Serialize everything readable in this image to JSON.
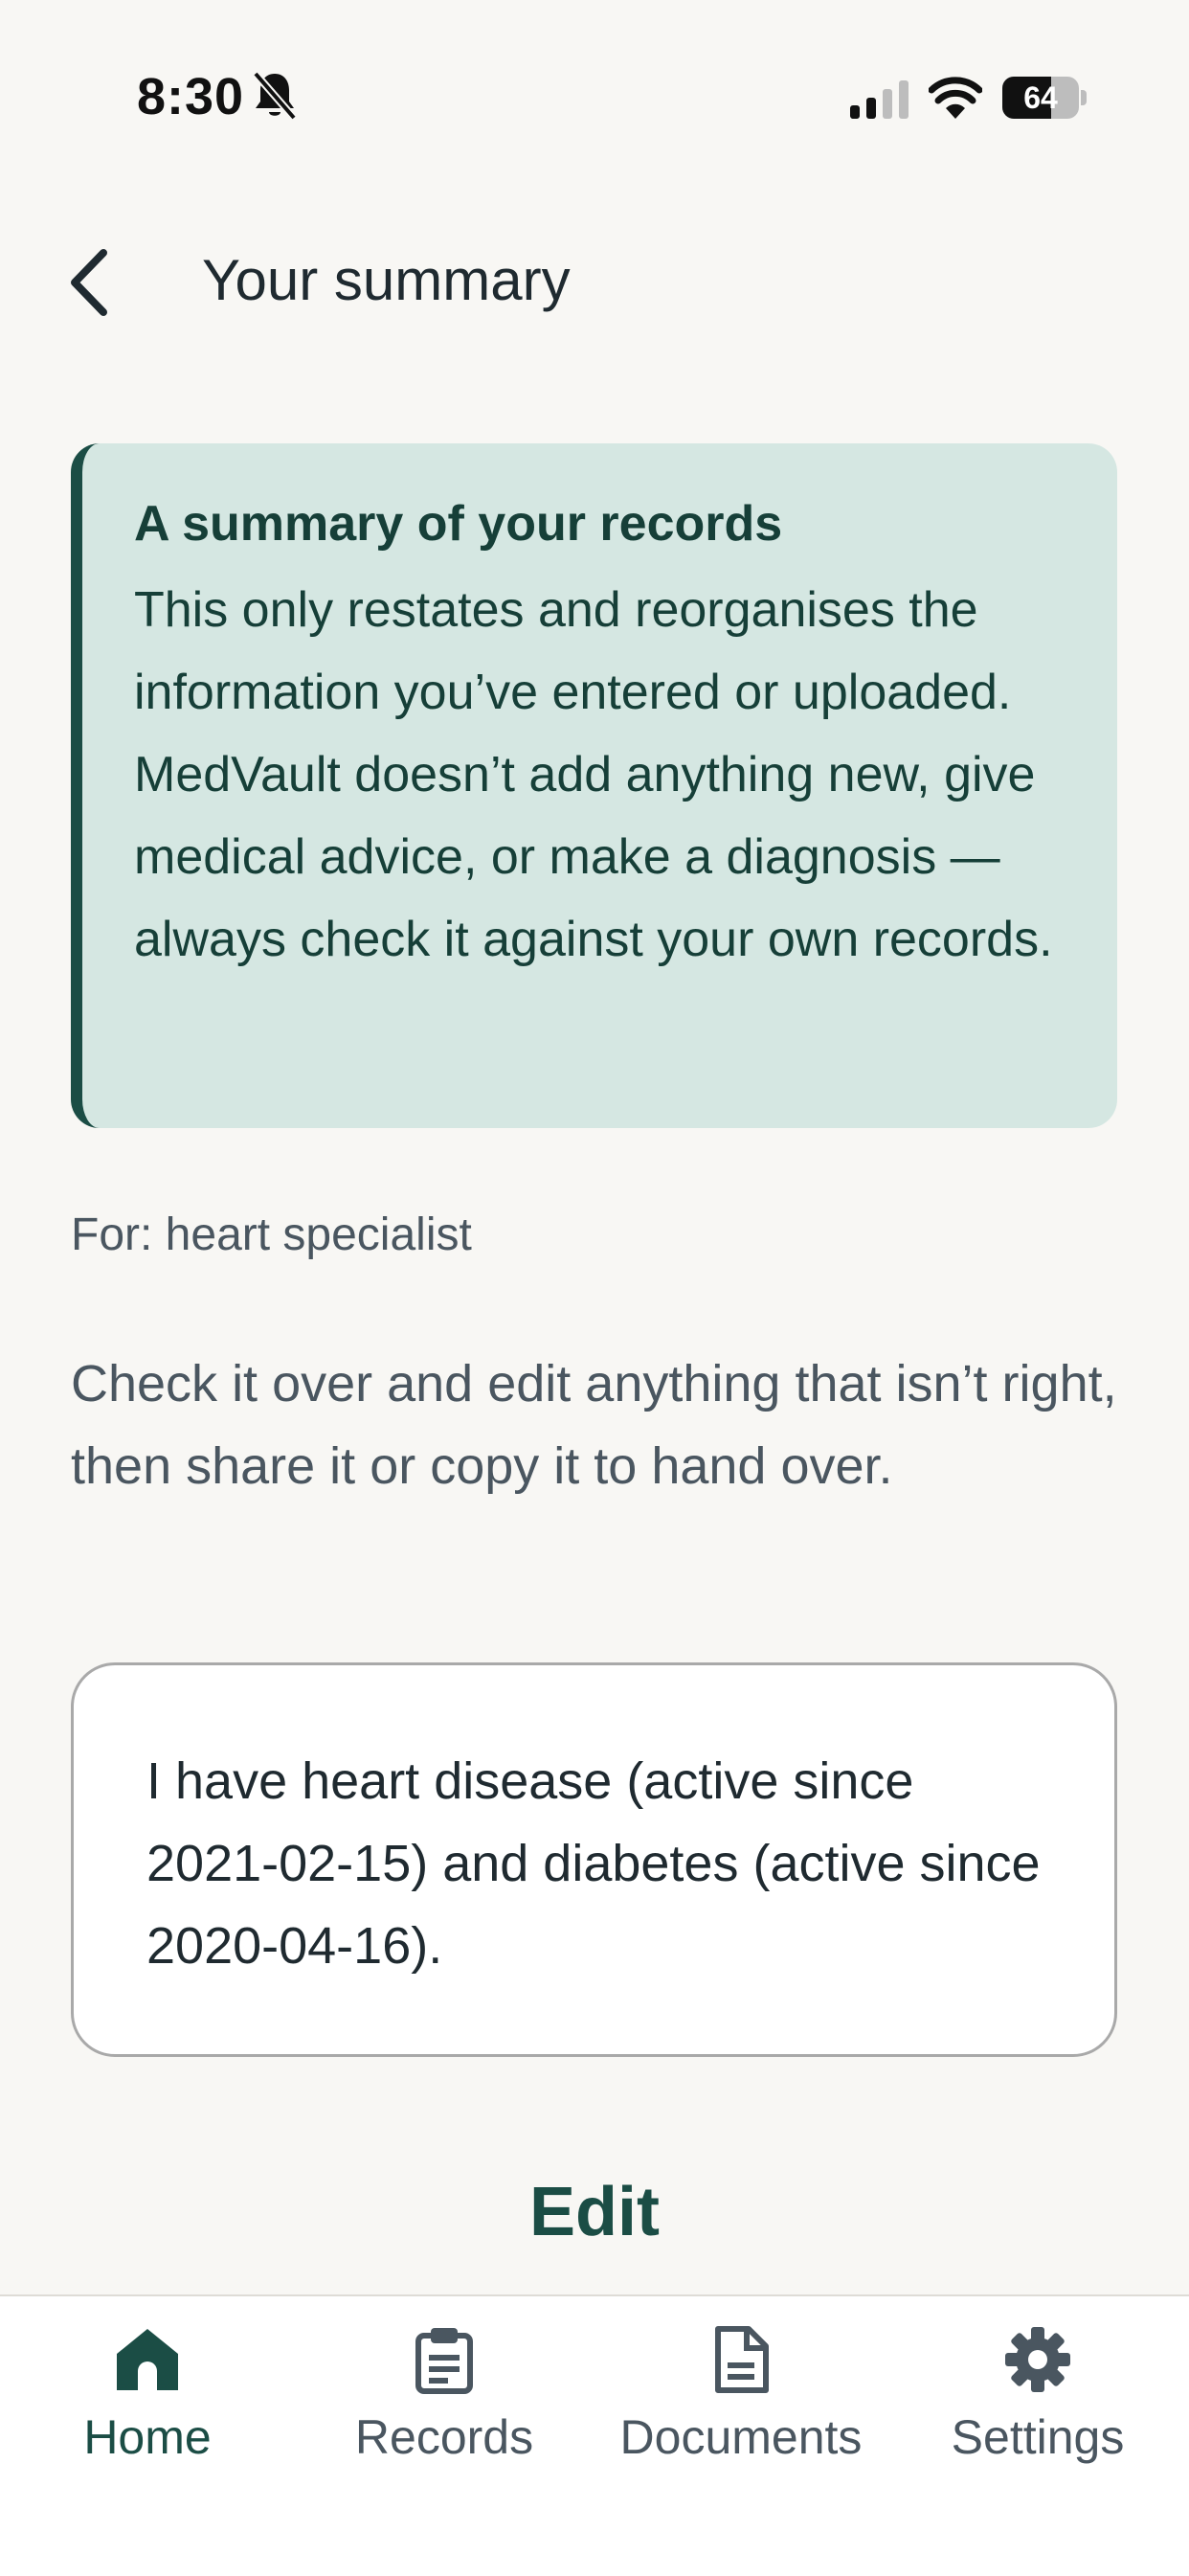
{
  "status_bar": {
    "time": "8:30",
    "battery_percent": "64",
    "battery_level": 0.64
  },
  "header": {
    "title": "Your summary"
  },
  "callout": {
    "title": "A summary of your records",
    "body": "This only restates and reorganises the information you’ve entered or uploaded. MedVault doesn’t add anything new, give medical advice, or make a diagnosis — always check it against your own records."
  },
  "for_line": "For: heart specialist",
  "instructions": "Check it over and edit anything that isn’t right, then share it or copy it to hand over.",
  "summary_text": "I have heart disease (active since 2021-02-15) and diabetes (active since 2020-04-16).",
  "edit_label": "Edit",
  "tabs": [
    {
      "label": "Home",
      "icon": "home-icon",
      "active": true
    },
    {
      "label": "Records",
      "icon": "clipboard-icon",
      "active": false
    },
    {
      "label": "Documents",
      "icon": "document-icon",
      "active": false
    },
    {
      "label": "Settings",
      "icon": "gear-icon",
      "active": false
    }
  ],
  "colors": {
    "accent": "#1b4d45",
    "callout_bg": "#d5e7e2",
    "background": "#f8f7f4",
    "muted_text": "#4a5660"
  }
}
